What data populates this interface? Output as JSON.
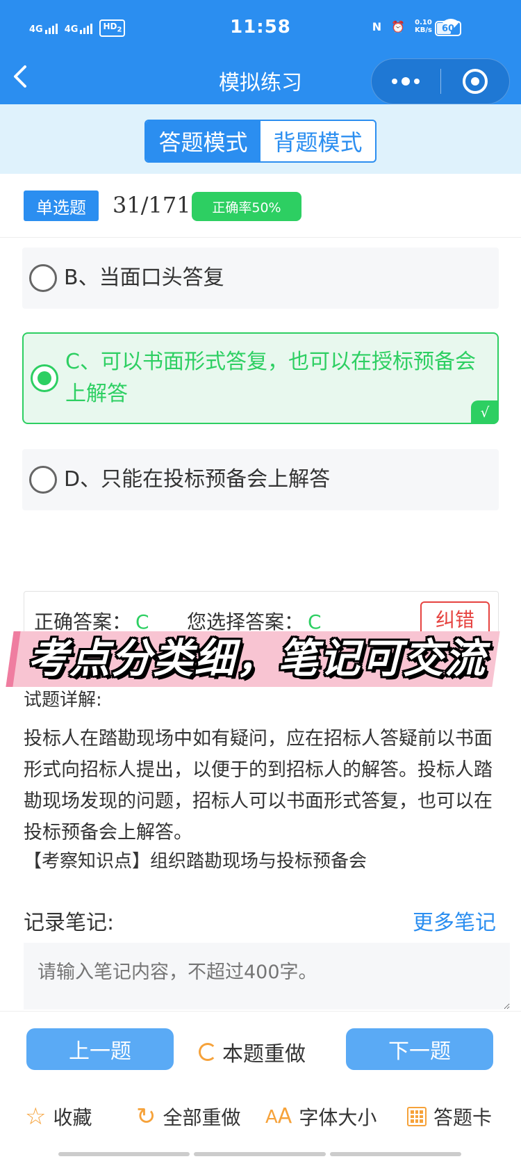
{
  "status_bar": {
    "network1": "4G",
    "network2": "4G",
    "hd_label": "HD",
    "hd_sub": "2",
    "time": "11:58",
    "nfc": "N",
    "speed_value": "0.10",
    "speed_unit": "KB/s",
    "battery": "60"
  },
  "nav": {
    "title": "模拟练习"
  },
  "modes": {
    "answer_mode": "答题模式",
    "memorize_mode": "背题模式"
  },
  "question": {
    "type": "单选题",
    "progress": "31/171",
    "accuracy": "正确率50%",
    "options": [
      {
        "label": "B、当面口头答复"
      },
      {
        "label": "C、可以书面形式答复，也可以在授标预备会上解答",
        "correct_mark": "√"
      },
      {
        "label": "D、只能在投标预备会上解答"
      }
    ]
  },
  "answer": {
    "correct_label": "正确答案：",
    "correct_value": "C",
    "selected_label": "您选择答案：",
    "selected_value": "C",
    "report_error": "纠错"
  },
  "banner": {
    "text": "考点分类细，笔记可交流"
  },
  "explanation": {
    "title": "试题详解:",
    "body": "投标人在踏勘现场中如有疑问，应在招标人答疑前以书面形式向招标人提出，以便于的到招标人的解答。投标人踏勘现场发现的问题，招标人可以书面形式答复，也可以在投标预备会上解答。",
    "knowledge_point": "【考察知识点】组织踏勘现场与投标预备会"
  },
  "notes": {
    "label": "记录笔记:",
    "more": "更多笔记",
    "placeholder": "请输入笔记内容，不超过400字。"
  },
  "actions": {
    "prev": "上一题",
    "redo": "本题重做",
    "next": "下一题"
  },
  "toolbar": {
    "favorite": "收藏",
    "redo_all": "全部重做",
    "font_size": "字体大小",
    "answer_card": "答题卡"
  },
  "colors": {
    "primary": "#2b8ef0",
    "correct": "#2dcf62",
    "error": "#e64340",
    "accent": "#f6a23a"
  }
}
